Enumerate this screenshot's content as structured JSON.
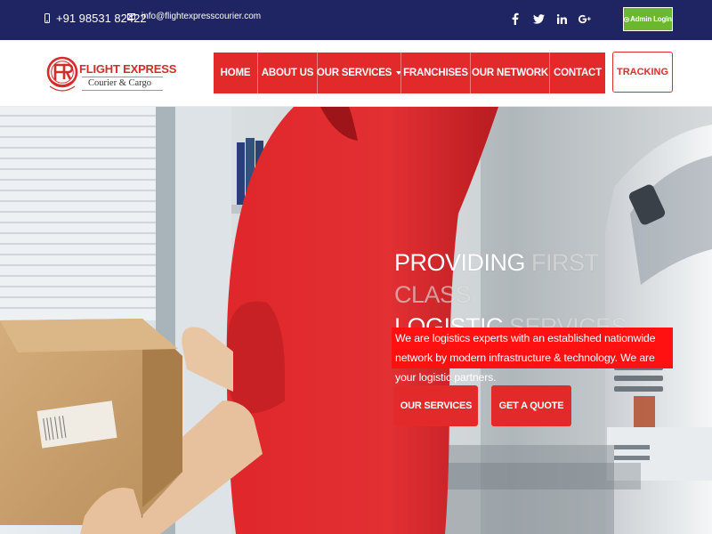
{
  "topbar": {
    "phone": "+91 98531 82422",
    "email": "info@flightexpresscourier.com",
    "social": [
      {
        "icon": "facebook-icon",
        "glyph": "f"
      },
      {
        "icon": "twitter-icon",
        "glyph": "t"
      },
      {
        "icon": "linkedin-icon",
        "glyph": "in"
      },
      {
        "icon": "google-plus-icon",
        "glyph": "G+"
      }
    ],
    "admin_login": "Admin Login"
  },
  "logo": {
    "brand": "FLIGHT EXPRESS",
    "tagline": "Courier & Cargo"
  },
  "nav": {
    "items": [
      {
        "label": "HOME"
      },
      {
        "label": "ABOUT US"
      },
      {
        "label": "OUR SERVICES"
      },
      {
        "label": "FRANCHISES"
      },
      {
        "label": "OUR NETWORK"
      },
      {
        "label": "CONTACT"
      }
    ],
    "tracking": "TRACKING"
  },
  "hero": {
    "title_line1_a": "PROVIDING ",
    "title_line1_b": "FIRST CLASS",
    "title_line2_a": "LOGISTIC ",
    "title_line2_b": "SERVICES",
    "description": "We are logistics experts with an established nationwide network by modern infrastructure & technology. We are your logistic partners.",
    "btn_services": "OUR SERVICES",
    "btn_quote": "GET A QUOTE"
  },
  "colors": {
    "topbar": "#1f2562",
    "accent_red": "#e32a2a",
    "admin_green": "#6bb82f"
  }
}
